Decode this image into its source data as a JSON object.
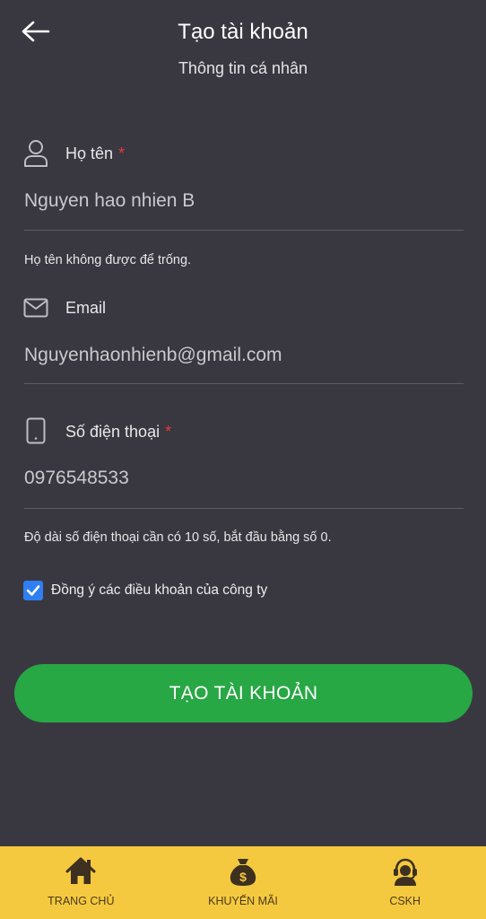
{
  "header": {
    "title": "Tạo tài khoản",
    "subtitle": "Thông tin cá nhân"
  },
  "form": {
    "name": {
      "label": "Họ tên",
      "required_mark": "*",
      "value": "Nguyen hao nhien B",
      "hint": "Họ tên không được để trống.",
      "icon": "user-icon"
    },
    "email": {
      "label": "Email",
      "value": "Nguyenhaonhienb@gmail.com",
      "icon": "envelope-icon"
    },
    "phone": {
      "label": "Số điện thoại",
      "required_mark": "*",
      "value": "0976548533",
      "hint": "Độ dài số điện thoại cần có 10 số, bắt đầu bằng số 0.",
      "icon": "phone-icon"
    },
    "agree": {
      "checked": true,
      "label": "Đồng ý các điều khoản của công ty"
    },
    "submit_label": "TẠO TÀI KHOẢN"
  },
  "bottom_nav": [
    {
      "label": "TRANG CHỦ",
      "icon": "home-icon"
    },
    {
      "label": "KHUYẾN MÃI",
      "icon": "money-bag-icon"
    },
    {
      "label": "CSKH",
      "icon": "support-agent-icon"
    }
  ],
  "colors": {
    "background": "#393841",
    "accent_green": "#28a745",
    "checkbox_blue": "#2f7ff2",
    "nav_yellow": "#f5c93f",
    "required_red": "#e53935"
  }
}
